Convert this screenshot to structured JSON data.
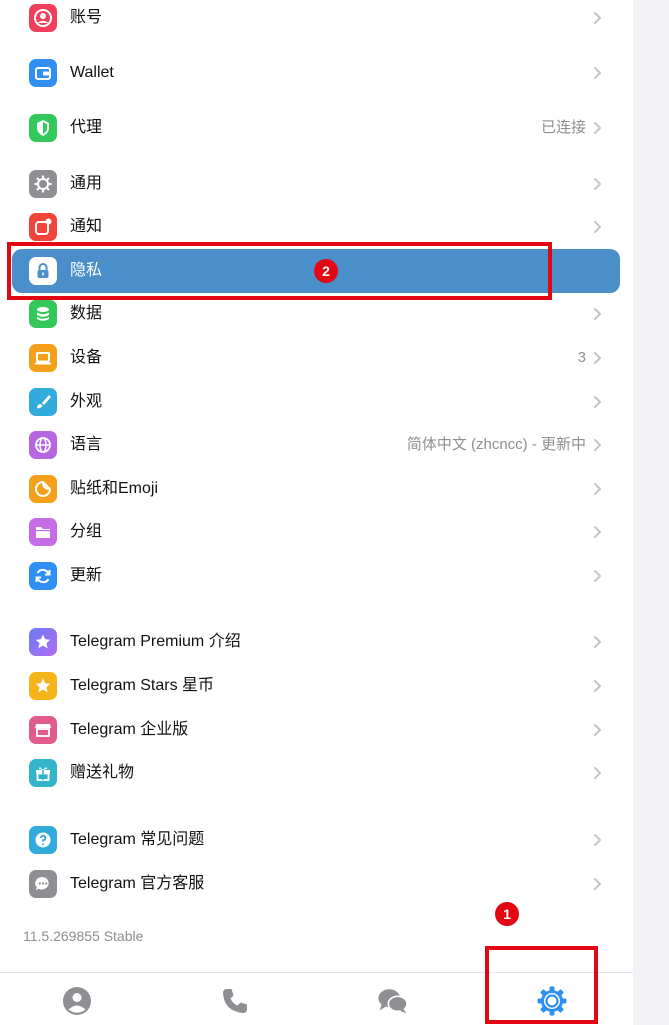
{
  "settings_items": [
    {
      "label": "账号",
      "value": "",
      "icon": "person-icon",
      "color": "#ef3f5b"
    },
    {
      "label": "Wallet",
      "value": "",
      "icon": "wallet-icon",
      "color": "#2f8ff2"
    },
    {
      "label": "代理",
      "value": "已连接",
      "icon": "shield-icon",
      "color": "#34c759"
    },
    {
      "label": "通用",
      "value": "",
      "icon": "gear-icon",
      "color": "#8e8e93"
    },
    {
      "label": "通知",
      "value": "",
      "icon": "notification-icon",
      "color": "#f2443a"
    },
    {
      "label": "隐私",
      "value": "",
      "icon": "lock-icon",
      "color": "#ffffff"
    },
    {
      "label": "数据",
      "value": "",
      "icon": "database-icon",
      "color": "#34c759"
    },
    {
      "label": "设备",
      "value": "3",
      "icon": "laptop-icon",
      "color": "#f5a01a"
    },
    {
      "label": "外观",
      "value": "",
      "icon": "brush-icon",
      "color": "#33aadc"
    },
    {
      "label": "语言",
      "value": "简体中文 (zhcncc) - 更新中",
      "icon": "globe-icon",
      "color": "#b667e0"
    },
    {
      "label": "贴纸和Emoji",
      "value": "",
      "icon": "sticker-icon",
      "color": "#f5a01a"
    },
    {
      "label": "分组",
      "value": "",
      "icon": "folder-icon",
      "color": "#c66ce6"
    },
    {
      "label": "更新",
      "value": "",
      "icon": "refresh-icon",
      "color": "#2f8ff2"
    },
    {
      "label": "Telegram Premium 介绍",
      "value": "",
      "icon": "premium-star-icon",
      "color": "#8a6cf2"
    },
    {
      "label": "Telegram Stars 星币",
      "value": "",
      "icon": "star-icon",
      "color": "#f5b51a"
    },
    {
      "label": "Telegram 企业版",
      "value": "",
      "icon": "store-icon",
      "color": "#e05c8c"
    },
    {
      "label": "赠送礼物",
      "value": "",
      "icon": "gift-icon",
      "color": "#33b4c8"
    },
    {
      "label": "Telegram 常见问题",
      "value": "",
      "icon": "question-icon",
      "color": "#33aadc"
    },
    {
      "label": "Telegram 官方客服",
      "value": "",
      "icon": "chat-support-icon",
      "color": "#8e8e93"
    }
  ],
  "selected_item": "隐私",
  "version": "11.5.269855 Stable",
  "annotations": {
    "step_1": "1",
    "step_2": "2"
  },
  "tab_bar": [
    {
      "icon": "contacts-icon",
      "active": false
    },
    {
      "icon": "calls-icon",
      "active": false
    },
    {
      "icon": "chats-icon",
      "active": false
    },
    {
      "icon": "settings-icon",
      "active": true
    }
  ],
  "colors": {
    "selected_row": "#4a8fca",
    "annotation_red": "#e30613",
    "active_tab": "#2f8ff2",
    "inactive_tab": "#8e8e93"
  }
}
